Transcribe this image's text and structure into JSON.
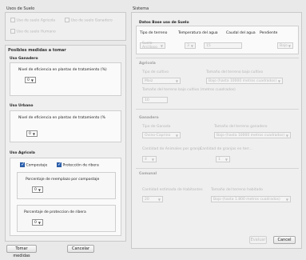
{
  "usos": {
    "title": "Usos de Suelo",
    "options": [
      {
        "label": "Uso de suelo Agricola"
      },
      {
        "label": "Uso de suelo Ganadero"
      },
      {
        "label": "Uso de suelo Humano"
      }
    ]
  },
  "posibles": {
    "title": "Posibles medidas a tomar",
    "ganadero": {
      "title": "Uso Ganadero",
      "field_label": "Nivel de eficiencia en plantas de tratamiento (%)",
      "value": "0"
    },
    "urbano": {
      "title": "Uso Urbano",
      "field_label": "Nivel de eficiencia en plantas de tratamiento (%",
      "value": "0"
    },
    "agricola": {
      "title": "Uso Agricola",
      "cb1": "Compostaje",
      "cb2": "Protección de ribera",
      "comp_label": "Porcentaje de reemplazo por compostaje",
      "comp_value": "0",
      "rib_label": "Porcentaje de proteccion de ribera",
      "rib_value": "0"
    }
  },
  "buttons": {
    "tomar": "Tomar medidas",
    "cancelar": "Cancelar",
    "evaluar": "Evaluar",
    "cancel": "Cancel"
  },
  "sistema": {
    "title": "Sistema",
    "base": {
      "title": "Datos Base uso de Suelo",
      "headers": [
        "Tipo de terreno",
        "Temperatura del agua",
        "Caudal del agua",
        "Pendiente"
      ],
      "values": [
        "Suelo Arcilloso",
        "3",
        "15",
        "Bajo"
      ]
    },
    "agricola": {
      "title": "Agricola",
      "l1": "Tipo de cultivo",
      "l2": "Tamaño del terreno bajo cultivo",
      "v1": "Maiz",
      "v2": "Bajo (hasta 10000 metros cuadrados)",
      "l3": "Tamaño del terreno bajo cultivo (metros cuadrados)",
      "v3": "10"
    },
    "ganadero": {
      "title": "Ganadero",
      "l1": "Tipo de Ganado",
      "l2": "Tamaño del terreno ganadero",
      "v1": "Ovino-Caprino",
      "v2": "Bajo (hasta 10000 metros cuadrados)",
      "l3": "Cantidad de Animales por granja",
      "l4": "Cantidad de granjas en terr...",
      "v3": "4",
      "v4": "1"
    },
    "comunal": {
      "title": "Comunal",
      "l1": "Cantidad estimada de Habitantes",
      "l2": "Tamaño del terreno habitado",
      "v1": "20",
      "v2": "Bajo (hasta 1.800 metros cuadrados)"
    }
  }
}
